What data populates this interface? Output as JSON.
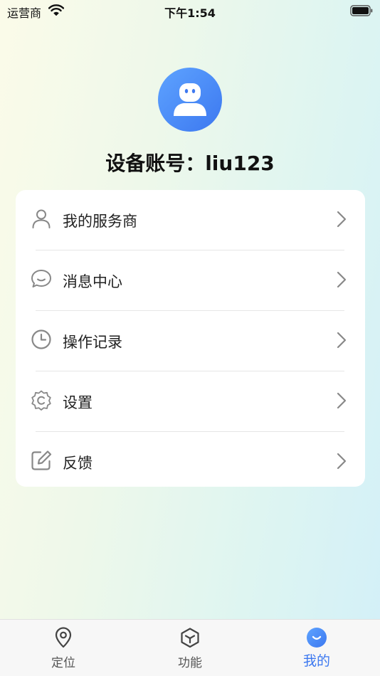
{
  "status_bar": {
    "carrier": "运营商",
    "time": "下午1:54"
  },
  "profile": {
    "account_label": "设备账号：liu123"
  },
  "menu": {
    "items": [
      {
        "label": "我的服务商",
        "icon": "person-icon"
      },
      {
        "label": "消息中心",
        "icon": "chat-bubble-icon"
      },
      {
        "label": "操作记录",
        "icon": "clock-icon"
      },
      {
        "label": "设置",
        "icon": "gear-icon"
      },
      {
        "label": "反馈",
        "icon": "edit-icon"
      }
    ]
  },
  "tabbar": {
    "tabs": [
      {
        "label": "定位",
        "icon": "location-pin-icon",
        "active": false
      },
      {
        "label": "功能",
        "icon": "cube-icon",
        "active": false
      },
      {
        "label": "我的",
        "icon": "smile-icon",
        "active": true
      }
    ]
  },
  "colors": {
    "accent": "#3c78f0",
    "icon_gray": "#888888"
  }
}
